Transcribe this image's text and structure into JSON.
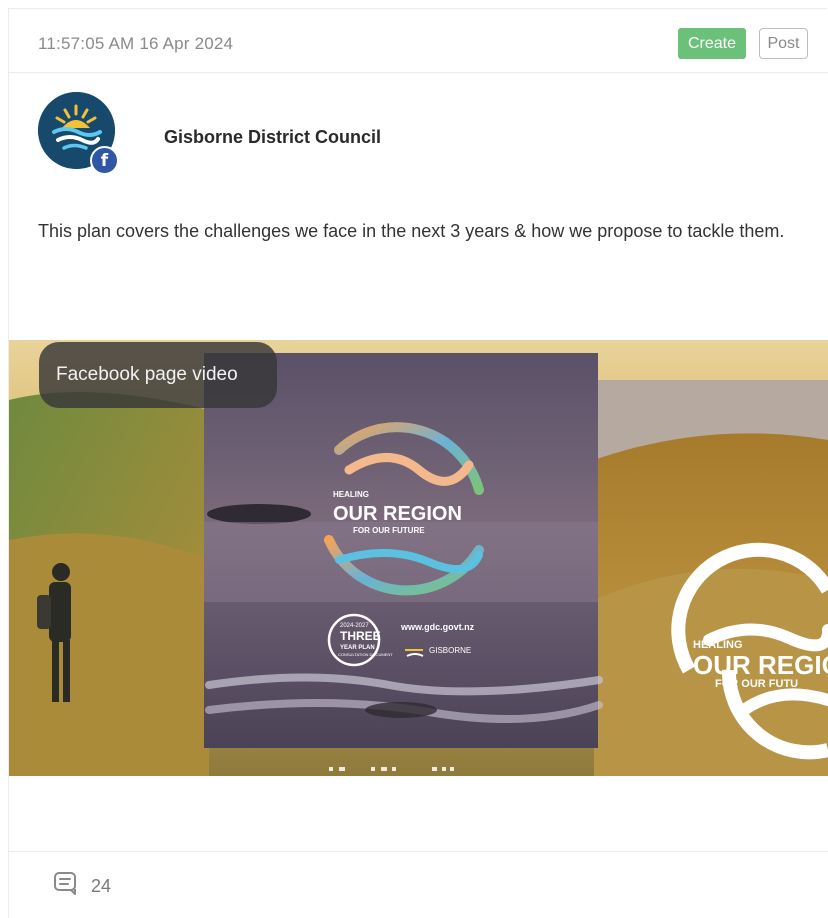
{
  "post": {
    "timestamp": "11:57:05 AM 16 Apr 2024",
    "actions": {
      "create_label": "Create",
      "post_label": "Post"
    },
    "account": {
      "name": "Gisborne District Council",
      "platform": "f"
    },
    "text": "This plan covers the challenges we face in the next 3 years & how we propose to tackle them.",
    "media": {
      "badge": "Facebook page video",
      "poster": {
        "left_top": "HEALING",
        "left_main": "OUR REGION",
        "left_bottom": "FOR OUR FUTURE",
        "url": "www.gdc.govt.nz",
        "plan_years": "2024-2027",
        "plan_title": "THREE",
        "plan_sub": "YEAR PLAN",
        "plan_doc": "CONSULTATION DOCUMENT",
        "org": "GISBORNE",
        "right_top": "HEALING",
        "right_main": "OUR REGIO",
        "right_bottom": "FOR OUR FUTU"
      }
    },
    "stats": {
      "comments": "24"
    },
    "colors": {
      "create": "#6cc17a",
      "facebook": "#2f57a5",
      "avatar": "#17496d"
    }
  }
}
